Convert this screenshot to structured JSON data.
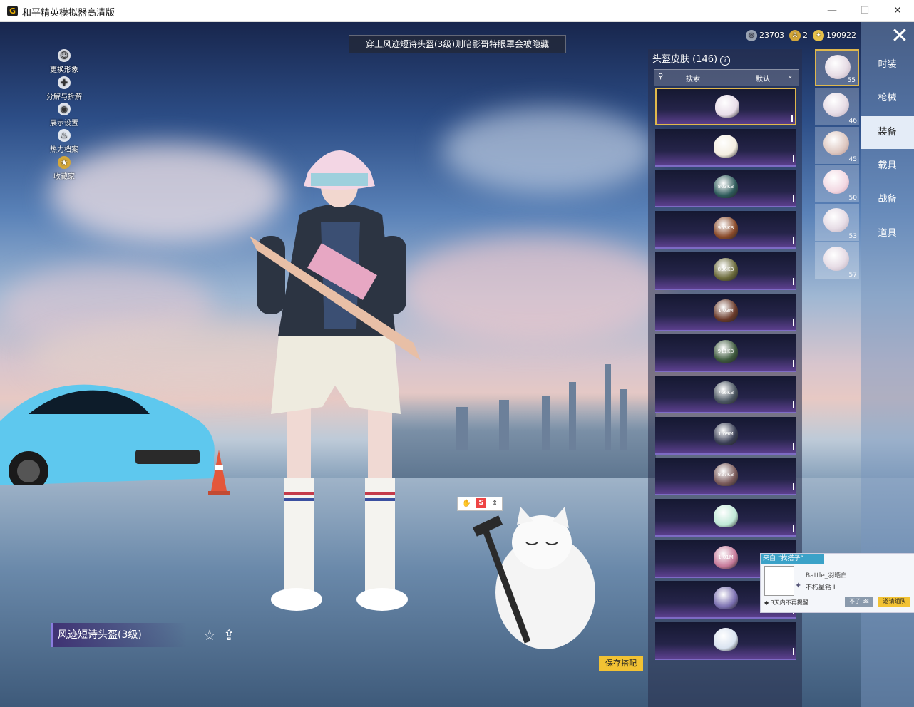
{
  "window": {
    "title": "和平精英模拟器高清版",
    "minimize": "—",
    "maximize": "☐",
    "close": "✕"
  },
  "banner": "穿上风迹短诗头盔(3级)则暗影哥特眼罩会被隐藏",
  "left_menu": [
    {
      "label": "更换形象",
      "icon": "avatar-icon"
    },
    {
      "label": "分解与拆解",
      "icon": "puzzle-icon"
    },
    {
      "label": "展示设置",
      "icon": "eye-icon"
    },
    {
      "label": "热力档案",
      "icon": "flame-icon"
    },
    {
      "label": "收藏家",
      "icon": "collector-icon"
    }
  ],
  "currency": [
    {
      "value": "23703",
      "icon": "silver-coin-icon",
      "color": "#9aa4b4"
    },
    {
      "value": "2",
      "icon": "coupon-icon",
      "color": "#d4a73a"
    },
    {
      "value": "190922",
      "icon": "gold-coin-icon",
      "color": "#e7c24a"
    }
  ],
  "panel": {
    "title": "头盔皮肤 (146)",
    "help": "?",
    "search_label": "搜索",
    "sort_label": "默认",
    "items": [
      {
        "name": "item-1",
        "size": "",
        "color": "#e8dce8",
        "selected": true
      },
      {
        "name": "item-2",
        "size": "",
        "color": "#f3ede0",
        "selected": false
      },
      {
        "name": "item-3",
        "size": "803KB",
        "color": "#2d5a5a",
        "selected": false
      },
      {
        "name": "item-4",
        "size": "953KB",
        "color": "#8a4a2a",
        "selected": false
      },
      {
        "name": "item-5",
        "size": "836KB",
        "color": "#6b6a3a",
        "selected": false
      },
      {
        "name": "item-6",
        "size": "1.03M",
        "color": "#6a3a2a",
        "selected": false
      },
      {
        "name": "item-7",
        "size": "911KB",
        "color": "#3e5a3e",
        "selected": false
      },
      {
        "name": "item-8",
        "size": "766KB",
        "color": "#4a5560",
        "selected": false
      },
      {
        "name": "item-9",
        "size": "1.09M",
        "color": "#3a3f55",
        "selected": false
      },
      {
        "name": "item-10",
        "size": "827KB",
        "color": "#7a5a5a",
        "selected": false
      },
      {
        "name": "item-11",
        "size": "",
        "color": "#bfe8d6",
        "selected": false
      },
      {
        "name": "item-12",
        "size": "1.01M",
        "color": "#c77a9a",
        "selected": false
      },
      {
        "name": "item-13",
        "size": "",
        "color": "#7a6fb0",
        "selected": false
      },
      {
        "name": "item-14",
        "size": "",
        "color": "#d9e3f0",
        "selected": false
      }
    ]
  },
  "quick_slots": [
    {
      "level": "55"
    },
    {
      "level": "46"
    },
    {
      "level": "45"
    },
    {
      "level": "50"
    },
    {
      "level": "53"
    },
    {
      "level": "57"
    }
  ],
  "nav": [
    {
      "label": "时装",
      "active": false
    },
    {
      "label": "枪械",
      "active": false
    },
    {
      "label": "装备",
      "active": true
    },
    {
      "label": "载具",
      "active": false
    },
    {
      "label": "战备",
      "active": false
    },
    {
      "label": "道具",
      "active": false
    }
  ],
  "helmet_name": "风迹短诗头盔(3级)",
  "save_label": "保存搭配",
  "notification": {
    "header": "来自 “找搭子”",
    "player": "Battle_羽皓白",
    "rank": "不朽星钻 I",
    "mute": "◆ 3天内不再提醒",
    "decline": "不了 3s",
    "accept": "邀请组队"
  },
  "ime": {
    "label": "S"
  }
}
